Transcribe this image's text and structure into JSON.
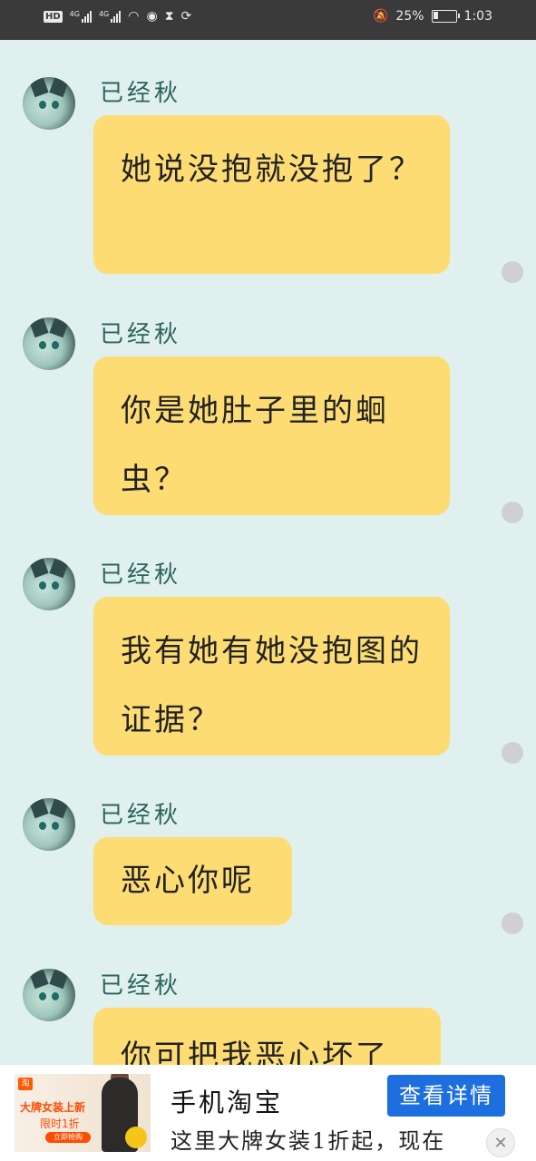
{
  "status_bar": {
    "left_indicators": [
      "HD",
      "4G",
      "4G"
    ],
    "battery_percent": "25%",
    "battery_level": 0.25,
    "time": "1:03",
    "icons": [
      "hd-icon",
      "signal-icon",
      "signal-icon",
      "wifi-icon",
      "globe-icon",
      "hourglass-icon",
      "sync-icon",
      "mute-bell-icon",
      "battery-icon"
    ]
  },
  "messages": [
    {
      "sender": "已经秋",
      "text": "她说没抱就没抱了？"
    },
    {
      "sender": "已经秋",
      "text": "你是她肚子里的蛔虫？"
    },
    {
      "sender": "已经秋",
      "text": "我有她有她没抱图的证据？"
    },
    {
      "sender": "已经秋",
      "text": "恶心你呢"
    },
    {
      "sender": "已经秋",
      "text": "你可把我恶心坏了"
    }
  ],
  "ad": {
    "logo": "淘",
    "image_line1": "大牌女装上新",
    "image_line2": "限时1折",
    "image_button": "立即抢购",
    "title": "手机淘宝",
    "description": "这里大牌女装1折起，现在",
    "button_label": "查看详情",
    "close_label": "✕"
  },
  "colors": {
    "background": "#dff0ef",
    "bubble": "#fddc74",
    "sender_name": "#2b6458",
    "ad_button": "#1d6fe0",
    "status_bar": "#3a3a3a"
  }
}
